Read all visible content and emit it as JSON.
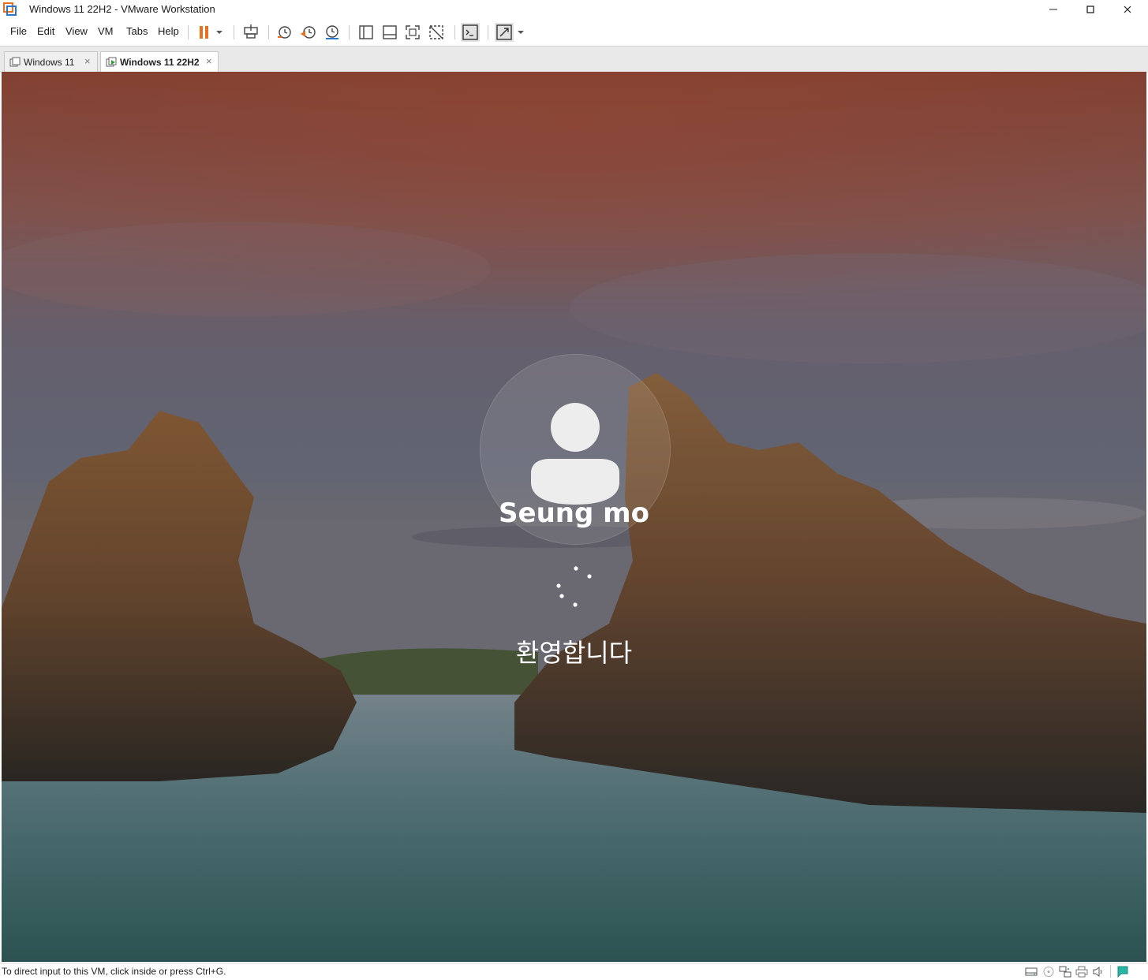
{
  "window": {
    "title": "Windows 11 22H2 - VMware Workstation",
    "controls": {
      "minimize": "–",
      "maximize": "□",
      "close": "×"
    }
  },
  "menu": {
    "items": [
      "File",
      "Edit",
      "View",
      "VM",
      "Tabs",
      "Help"
    ]
  },
  "toolbar": {
    "icons": [
      "pause-icon",
      "dropdown-arrow-icon",
      "send-ctrl-alt-del-icon",
      "snapshot-take-icon",
      "snapshot-revert-icon",
      "snapshot-manager-icon",
      "show-library-icon",
      "show-thumbnail-icon",
      "full-screen-icon",
      "unity-icon",
      "console-view-icon",
      "stretch-guest-icon",
      "stretch-dropdown-icon"
    ]
  },
  "tabs": [
    {
      "label": "Windows 11",
      "active": false,
      "close": "×"
    },
    {
      "label": "Windows 11 22H2",
      "active": true,
      "close": "×"
    }
  ],
  "vm": {
    "user_name": "Seung mo",
    "welcome": "환영합니다"
  },
  "statusbar": {
    "hint": "To direct input to this VM, click inside or press Ctrl+G.",
    "icons": [
      "hard-disk-icon",
      "cd-dvd-icon",
      "network-icon",
      "printer-icon",
      "sound-icon",
      "message-log-icon"
    ]
  },
  "colors": {
    "accent_pause": "#e8701f",
    "sky_top": "#8a3e35",
    "water": "#3f6a6c"
  }
}
